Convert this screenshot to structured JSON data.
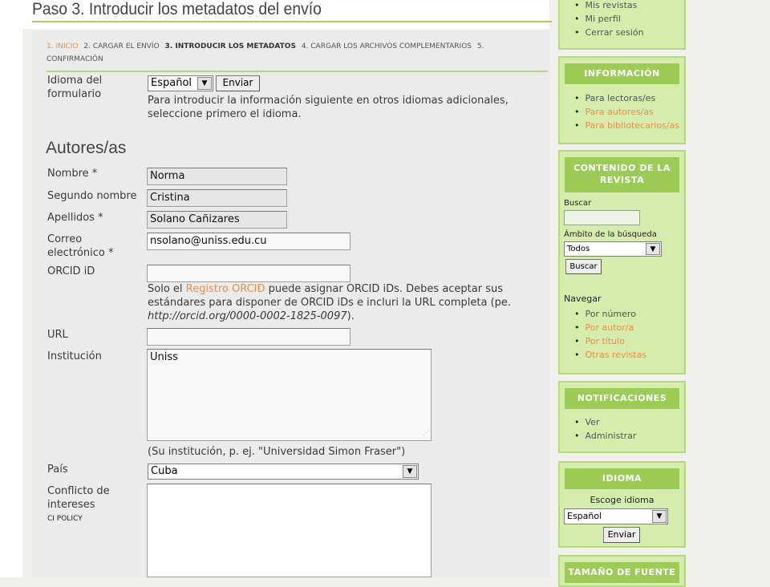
{
  "page": {
    "title": "Paso 3. Introducir los metadatos del envío",
    "steps": [
      {
        "label": "1. INICIO",
        "state": "done"
      },
      {
        "label": "2. CARGAR EL ENVÍO",
        "state": "pending"
      },
      {
        "label": "3. INTRODUCIR LOS METADATOS",
        "state": "current"
      },
      {
        "label": "4. CARGAR LOS ARCHIVOS COMPLEMENTARIOS",
        "state": "pending"
      },
      {
        "label": "5. CONFIRMACIÓN",
        "state": "pending"
      }
    ]
  },
  "form_language": {
    "label": "Idioma del formulario",
    "selected": "Español",
    "submit_label": "Enviar",
    "help": "Para introducir la información siguiente en otros idiomas adicionales, seleccione primero el idioma."
  },
  "authors": {
    "heading": "Autores/as",
    "first_name": {
      "label": "Nombre *",
      "value": "Norma"
    },
    "middle_name": {
      "label": "Segundo nombre",
      "value": "Cristina"
    },
    "last_name": {
      "label": "Apellidos *",
      "value": "Solano Cañizares"
    },
    "email": {
      "label": "Correo electrónico *",
      "value": "nsolano@uniss.edu.cu"
    },
    "orcid": {
      "label": "ORCID iD",
      "value": "",
      "help_prefix": "Solo el ",
      "help_link": "Registro ORCID",
      "help_rest": " puede asignar ORCID iDs. Debes aceptar sus estándares para disponer de ORCID iDs e incluri la URL completa (pe.",
      "help_example": "http://orcid.org/0000-0002-1825-0097",
      "help_end": ")."
    },
    "url": {
      "label": "URL",
      "value": ""
    },
    "institution": {
      "label": "Institución",
      "value": "Uniss",
      "hint": "(Su institución, p. ej. \"Universidad Simon Fraser\")"
    },
    "country": {
      "label": "País",
      "selected": "Cuba"
    },
    "conflict": {
      "label": "Conflicto de intereses",
      "link": "CI POLICY",
      "value": ""
    }
  },
  "sidebar": {
    "user_links": [
      "Mis revistas",
      "Mi perfil",
      "Cerrar sesión"
    ],
    "info": {
      "title": "INFORMACIÓN",
      "links": [
        "Para lectoras/es",
        "Para autores/as",
        "Para bibliotecarios/as"
      ]
    },
    "journal_content": {
      "title": "CONTENIDO DE LA REVISTA",
      "search_label": "Buscar",
      "scope_label": "Ámbito de la búsqueda",
      "scope_selected": "Todos",
      "search_button": "Buscar",
      "browse_label": "Navegar",
      "browse_links": [
        "Por número",
        "Por autor/a",
        "Por título",
        "Otras revistas"
      ]
    },
    "notifications": {
      "title": "NOTIFICACIONES",
      "links": [
        "Ver",
        "Administrar"
      ]
    },
    "language": {
      "title": "IDIOMA",
      "choose_label": "Escoge idioma",
      "selected": "Español",
      "submit_label": "Enviar"
    },
    "font_size": {
      "title": "TAMAÑO DE FUENTE"
    }
  },
  "colors": {
    "accent_green": "#9ccb56",
    "sidebar_bg": "#d6ecad",
    "link_orange": "#e8904a"
  }
}
